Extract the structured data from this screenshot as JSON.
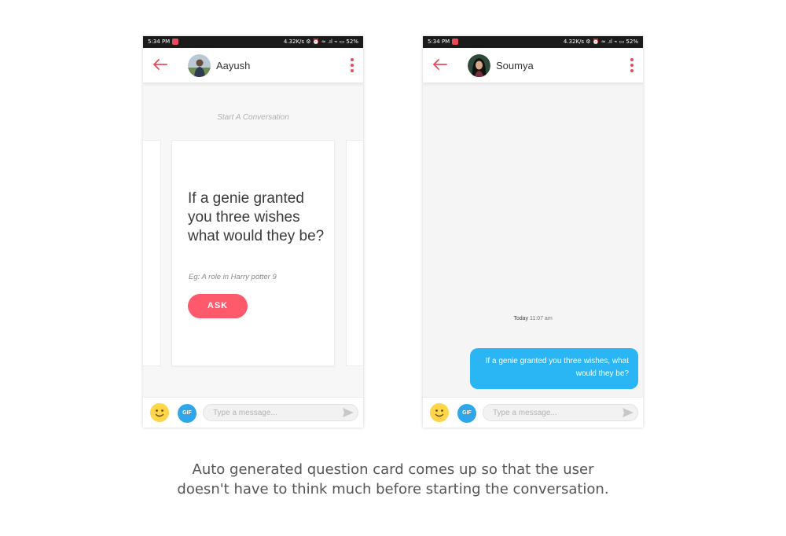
{
  "status_bar": {
    "time": "5:34 PM",
    "right": "4.32K/s ⚙ ⏰ ≈ .ıl ⌁ ▭ 52%"
  },
  "phones": [
    {
      "contact_name": "Aayush",
      "chat_hint": "Start A Conversation",
      "question_card": {
        "question": "If a genie granted you three wishes what would they be?",
        "example": "Eg: A role in Harry potter 9",
        "ask_label": "ASK"
      },
      "composer": {
        "gif_label": "GIF",
        "placeholder": "Type a message..."
      }
    },
    {
      "contact_name": "Soumya",
      "timestamp_day": "Today",
      "timestamp_time": "11:07 am",
      "sent_message": "If a genie granted you three wishes, what would they be?",
      "composer": {
        "gif_label": "GIF",
        "placeholder": "Type a message..."
      }
    }
  ],
  "caption": {
    "line1": "Auto generated question card comes up so that the user",
    "line2": "doesn't have to think much before starting the conversation."
  },
  "colors": {
    "accent": "#ff5a6c",
    "bubble": "#2ab5f5",
    "gif": "#2fa6ea",
    "smiley": "#ffd54a"
  },
  "icons": [
    "back-arrow-icon",
    "more-vert-icon",
    "smiley-icon",
    "gif-icon",
    "send-icon",
    "notification-icon"
  ]
}
